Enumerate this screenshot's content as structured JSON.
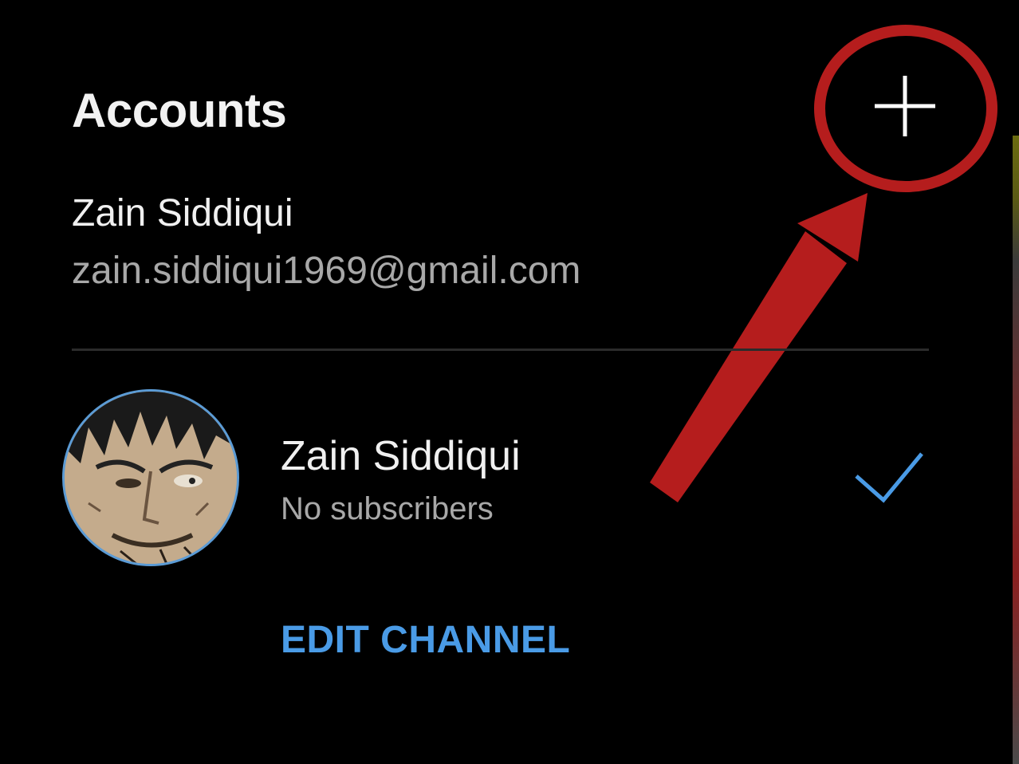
{
  "header": {
    "title": "Accounts",
    "add_button_icon": "plus-icon"
  },
  "current_account": {
    "name": "Zain Siddiqui",
    "email": "zain.siddiqui1969@gmail.com"
  },
  "channel": {
    "name": "Zain Siddiqui",
    "subscribers": "No subscribers",
    "avatar_icon": "avatar-image",
    "selected_icon": "checkmark-icon",
    "edit_label": "EDIT CHANNEL"
  },
  "colors": {
    "background": "#000000",
    "accent_blue": "#4a9be6",
    "annotation_red": "#b51d1d",
    "secondary_text": "#a8a8a8"
  }
}
